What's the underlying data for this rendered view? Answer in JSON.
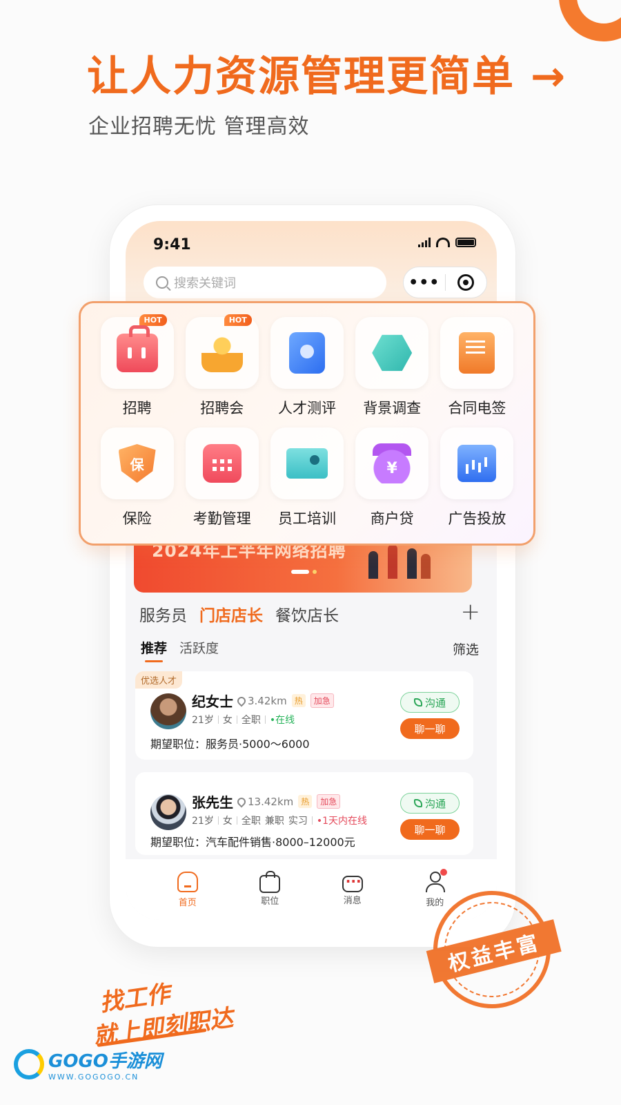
{
  "headline": "让人力资源管理更简单 →",
  "subline": "企业招聘无忧 管理高效",
  "status": {
    "time": "9:41"
  },
  "search": {
    "placeholder": "搜索关键词"
  },
  "capsule": {
    "more": "•••"
  },
  "features": [
    {
      "label": "招聘",
      "icon": "briefcase-icon",
      "hot": "HOT"
    },
    {
      "label": "招聘会",
      "icon": "people-icon",
      "hot": "HOT"
    },
    {
      "label": "人才测评",
      "icon": "id-badge-icon"
    },
    {
      "label": "背景调查",
      "icon": "hexagon-people-icon"
    },
    {
      "label": "合同电签",
      "icon": "contract-icon"
    },
    {
      "label": "保险",
      "icon": "shield-icon",
      "glyph": "保"
    },
    {
      "label": "考勤管理",
      "icon": "calendar-icon"
    },
    {
      "label": "员工培训",
      "icon": "training-board-icon"
    },
    {
      "label": "商户贷",
      "icon": "money-bag-icon",
      "glyph": "¥"
    },
    {
      "label": "广告投放",
      "icon": "bar-chart-icon"
    }
  ],
  "banner": {
    "text": "2024年上半年网络招聘"
  },
  "category_tabs": [
    "服务员",
    "门店店长",
    "餐饮店长"
  ],
  "category_active": 1,
  "add_symbol": "+",
  "sub_tabs": [
    "推荐",
    "活跃度"
  ],
  "filter_label": "筛选",
  "candidates": [
    {
      "badge": "优选人才",
      "name": "纪女士",
      "distance": "3.42km",
      "hot": "热",
      "urgent": "加急",
      "age": "21岁",
      "gender": "女",
      "type": "全职",
      "status": "•在线",
      "expect": "期望职位：服务员·5000～6000",
      "call": "沟通",
      "chat": "聊一聊"
    },
    {
      "name": "张先生",
      "distance": "13.42km",
      "hot": "热",
      "urgent": "加急",
      "age": "21岁",
      "gender": "女",
      "type": "全职",
      "type2": "兼职",
      "type3": "实习",
      "status": "•1天内在线",
      "expect": "期望职位：汽车配件销售·8000–12000元",
      "call": "沟通",
      "chat": "聊一聊"
    }
  ],
  "tabbar": [
    {
      "label": "首页",
      "icon": "home-icon",
      "active": true
    },
    {
      "label": "职位",
      "icon": "bag-icon"
    },
    {
      "label": "消息",
      "icon": "message-icon"
    },
    {
      "label": "我的",
      "icon": "user-icon",
      "dot": true
    }
  ],
  "stamp": {
    "text": "权益丰富"
  },
  "slogan": {
    "line1": "找工作",
    "line2": "就上即刻职达"
  },
  "watermark": {
    "name": "GOGO手游网",
    "url": "WWW.GOGOGO.CN"
  },
  "colors": {
    "accent": "#f06a1d",
    "green": "#2aa657",
    "urgent": "#e44a5b"
  }
}
